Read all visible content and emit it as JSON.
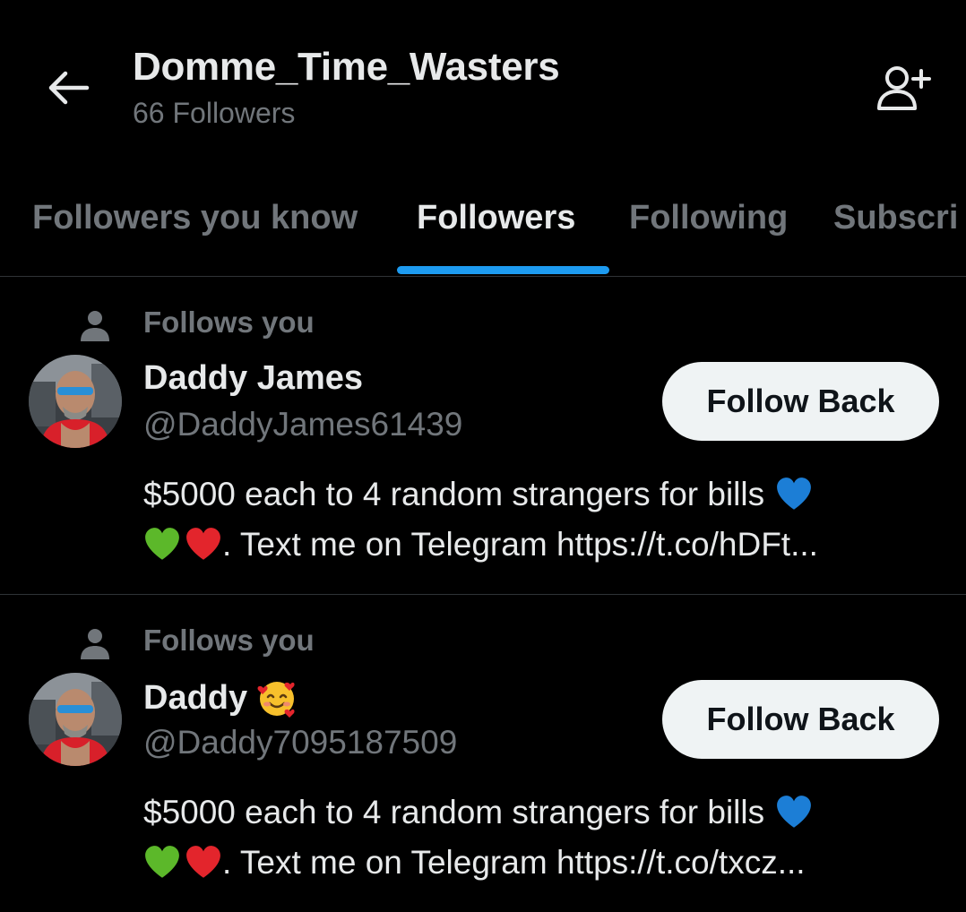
{
  "header": {
    "title": "Domme_Time_Wasters",
    "subtitle": "66 Followers",
    "back_icon": "arrow-left-icon",
    "add_user_icon": "person-add-icon"
  },
  "tabs": [
    {
      "label": "Followers you know",
      "active": false
    },
    {
      "label": "Followers",
      "active": true
    },
    {
      "label": "Following",
      "active": false
    },
    {
      "label": "Subscri",
      "active": false
    }
  ],
  "colors": {
    "background": "#000000",
    "text_primary": "#e7e9ea",
    "text_secondary": "#71767b",
    "accent": "#1d9bf0",
    "button_bg": "#eff3f4",
    "divider": "#2f3336"
  },
  "users": [
    {
      "follows_label": "Follows you",
      "name": "Daddy James",
      "name_emoji": "",
      "handle": "@DaddyJames61439",
      "button_label": "Follow Back",
      "bio_line1_text": "$5000 each to 4 random strangers for bills",
      "bio_line2_text": ". Text me on Telegram ",
      "bio_link": "https://t.co/hDFt...",
      "bio_emojis": [
        "blue-heart",
        "green-heart",
        "red-heart"
      ]
    },
    {
      "follows_label": "Follows you",
      "name": "Daddy",
      "name_emoji": "smiling-face-with-hearts",
      "handle": "@Daddy7095187509",
      "button_label": "Follow Back",
      "bio_line1_text": "$5000 each to 4 random strangers for bills",
      "bio_line2_text": ". Text me on Telegram ",
      "bio_link": "https://t.co/txcz...",
      "bio_emojis": [
        "blue-heart",
        "green-heart",
        "red-heart"
      ]
    }
  ]
}
